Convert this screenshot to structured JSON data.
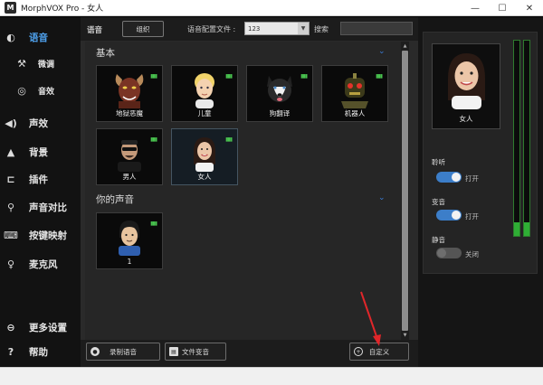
{
  "window": {
    "title": "MorphVOX Pro - 女人",
    "logo_text": "M",
    "controls": {
      "minimize": "—",
      "maximize": "☐",
      "close": "✕"
    }
  },
  "sidebar": {
    "items": [
      {
        "label": "语音",
        "icon": "voice-icon",
        "glyph": "◐",
        "active": true
      },
      {
        "label": "微调",
        "icon": "wrench-icon",
        "glyph": "⚒",
        "sub": true
      },
      {
        "label": "音效",
        "icon": "lips-icon",
        "glyph": "◎",
        "sub": true
      },
      {
        "label": "声效",
        "icon": "speaker-icon",
        "glyph": "◀)"
      },
      {
        "label": "背景",
        "icon": "mountain-icon",
        "glyph": "▲"
      },
      {
        "label": "插件",
        "icon": "plug-icon",
        "glyph": "⊏"
      },
      {
        "label": "声音对比",
        "icon": "magnifier-icon",
        "glyph": "⚲"
      },
      {
        "label": "按键映射",
        "icon": "keyboard-icon",
        "glyph": "⌨"
      },
      {
        "label": "麦克风",
        "icon": "microphone-icon",
        "glyph": "♀"
      },
      {
        "label": "更多设置",
        "icon": "more-settings-icon",
        "glyph": "⊖"
      },
      {
        "label": "帮助",
        "icon": "help-icon",
        "glyph": "?"
      }
    ]
  },
  "toolbar": {
    "section_label": "语音",
    "group_button": "组织",
    "config_label": "语音配置文件 :",
    "config_value": "123",
    "search_label": "搜索"
  },
  "voices": {
    "basic_title": "基本",
    "basic": [
      {
        "name": "地狱恶魔",
        "avatar": "demon-avatar"
      },
      {
        "name": "儿童",
        "avatar": "child-avatar"
      },
      {
        "name": "狗翻译",
        "avatar": "dog-avatar"
      },
      {
        "name": "机器人",
        "avatar": "robot-avatar"
      },
      {
        "name": "男人",
        "avatar": "man-avatar"
      },
      {
        "name": "女人",
        "avatar": "woman-avatar",
        "selected": true
      }
    ],
    "custom_title": "你的声音",
    "custom": [
      {
        "name": "1",
        "avatar": "custom-avatar"
      }
    ],
    "signal_glyph": "▮▮▮"
  },
  "bottom_bar": {
    "record_label": "录制语音",
    "file_label": "文件变音",
    "custom_label": "自定义"
  },
  "right_panel": {
    "current_voice": "女人",
    "listen_label": "聆听",
    "listen_state": "打开",
    "listen_on": true,
    "voice_change_label": "变音",
    "voice_change_state": "打开",
    "voice_change_on": true,
    "mute_label": "静音",
    "mute_state": "关闭",
    "mute_on": false,
    "meter_levels": [
      0.07,
      0.07
    ]
  },
  "colors": {
    "accent": "#4fa3f0",
    "toggle_on": "#3c7ec9",
    "meter": "#2fae35",
    "annotation_arrow": "#e0262a"
  }
}
